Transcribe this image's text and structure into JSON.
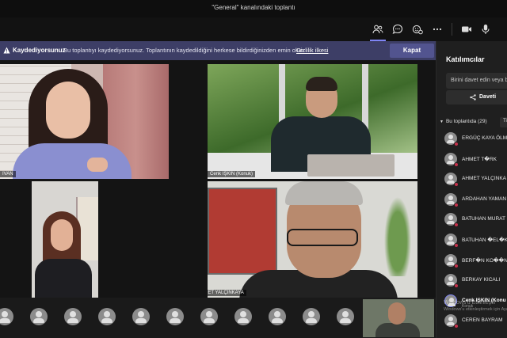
{
  "window": {
    "title": "\"General\" kanalındaki toplantı"
  },
  "toolbar": {
    "icons": [
      "people-icon",
      "chat-icon",
      "reactions-icon",
      "more-icon",
      "camera-icon",
      "microphone-icon"
    ]
  },
  "banner": {
    "title": "Kaydediyorsunuz",
    "text": "Bu toplantıyı kaydediyorsunuz. Toplantının kaydedildiğini herkese bildirdiğinizden emin olun.",
    "link": "Gizlilik ilkesi",
    "button": "Kapat"
  },
  "tiles": [
    {
      "name": "IVAN"
    },
    {
      "name": "Cenk IŞKIN (Konuk)"
    },
    {
      "name": ""
    },
    {
      "name": "AHMET YALÇINKAYA"
    }
  ],
  "panel": {
    "title": "Katılımcılar",
    "invite_placeholder": "Birini davet edin veya bir",
    "share_label": "Daveti",
    "section_label": "Bu toplantıda (29)",
    "section_button": "Ti",
    "participants": [
      {
        "name": "ERGÜÇ KAYA ÖLM",
        "muted": true,
        "presenting": false,
        "sub": ""
      },
      {
        "name": "AHMET T�RK",
        "muted": true,
        "presenting": false,
        "sub": ""
      },
      {
        "name": "AHMET YALÇINKA",
        "muted": true,
        "presenting": false,
        "sub": ""
      },
      {
        "name": "ARDAHAN YAMAN",
        "muted": true,
        "presenting": false,
        "sub": ""
      },
      {
        "name": "BATUHAN MURAT",
        "muted": true,
        "presenting": false,
        "sub": ""
      },
      {
        "name": "BATUHAN �EL�K",
        "muted": true,
        "presenting": false,
        "sub": ""
      },
      {
        "name": "BERF�N KO��N",
        "muted": true,
        "presenting": false,
        "sub": ""
      },
      {
        "name": "BERKAY KICALI",
        "muted": true,
        "presenting": false,
        "sub": ""
      },
      {
        "name": "Cenk IŞKIN (Konu",
        "muted": false,
        "presenting": true,
        "sub": "Konuk"
      },
      {
        "name": "CEREN BAYRAM",
        "muted": true,
        "presenting": false,
        "sub": ""
      }
    ]
  },
  "watermark": {
    "line1": "Windows'u Etkinleştir",
    "line2": "Windows'u etkinleştirmek için Ayarlar'a gidin."
  },
  "strip": {
    "avatar_count": 11
  },
  "colors": {
    "accent": "#7f85f5",
    "banner": "#3d3e66",
    "mute": "#c4314b"
  }
}
